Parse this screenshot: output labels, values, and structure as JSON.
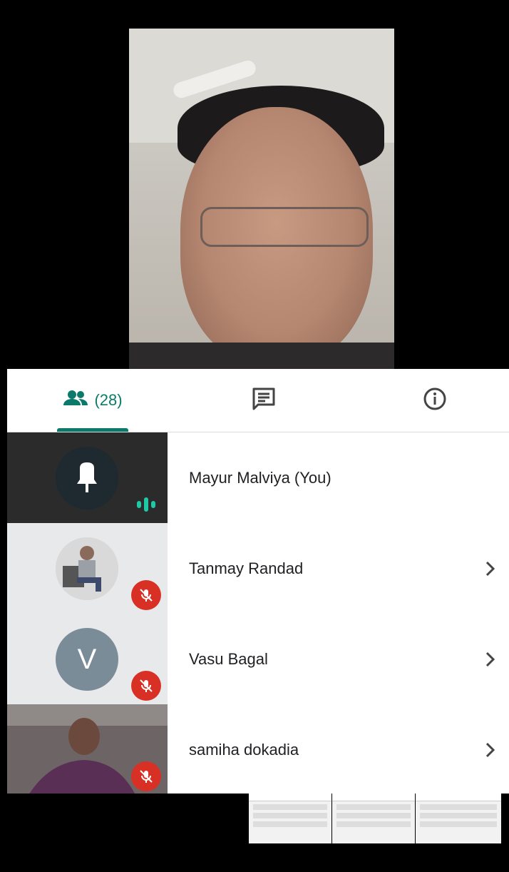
{
  "tabs": {
    "people_count": "(28)"
  },
  "participants": [
    {
      "name": "Mayur Malviya (You)"
    },
    {
      "name": "Tanmay Randad"
    },
    {
      "name": "Vasu Bagal",
      "initial": "V"
    },
    {
      "name": "samiha dokadia"
    }
  ],
  "colors": {
    "accent": "#0b7a6b",
    "mute": "#d93025",
    "avatar_letter_bg": "#7b8c99"
  },
  "icons": [
    "people-icon",
    "chat-icon",
    "info-icon",
    "chevron-right-icon",
    "mic-off-icon",
    "speaking-indicator-icon"
  ]
}
